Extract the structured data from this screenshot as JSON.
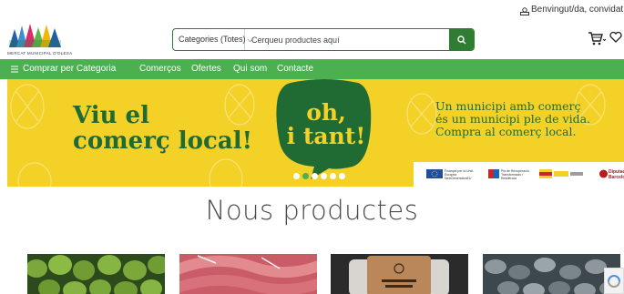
{
  "user": {
    "greeting": "Benvingut/da, convidat"
  },
  "logo": {
    "name": "MERCAT MUNICIPAL D'OLESA"
  },
  "search": {
    "category": "Categories (Totes)",
    "placeholder": "Cerqueu productes aquí"
  },
  "nav": {
    "menu_label": "Comprar per Categoria",
    "items": [
      "Comerços",
      "Ofertes",
      "Qui som",
      "Contacte"
    ]
  },
  "banner": {
    "headline_line1": "Viu el",
    "headline_line2": "comerç local!",
    "bubble_line1": "oh,",
    "bubble_line2": "i tant!",
    "tagline_line1": "Un municipi amb comerç",
    "tagline_line2": "és un municipi ple de vida.",
    "tagline_line3": "Compra al comerç local.",
    "slides_count": 6,
    "active_slide": 1,
    "sponsors": {
      "eu": "Finançat per la Unió Europea NextGenerationEU",
      "plan": "Pla de Recuperació, Transformació i Resiliència",
      "diputacio": "Diputació Barcelona"
    }
  },
  "section": {
    "title": "Nous productes"
  },
  "colors": {
    "green": "#4caf50",
    "dark_green": "#2e7d32",
    "banner_yellow": "#f4d126",
    "banner_text": "#1f6b33"
  }
}
